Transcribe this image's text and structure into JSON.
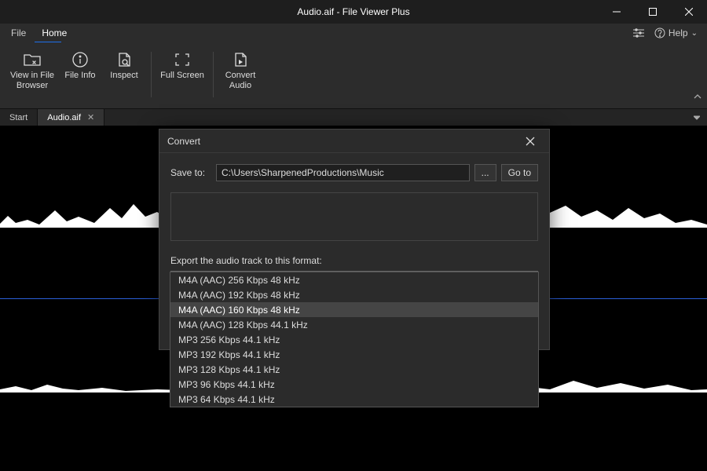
{
  "titlebar": {
    "title": "Audio.aif - File Viewer Plus"
  },
  "menubar": {
    "file": "File",
    "home": "Home",
    "help": "Help ",
    "help_caret": "⌄"
  },
  "ribbon": {
    "view_in_browser": "View in File\nBrowser",
    "file_info": "File Info",
    "inspect": "Inspect",
    "full_screen": "Full Screen",
    "convert_audio": "Convert\nAudio"
  },
  "tabs": {
    "start": "Start",
    "audio": "Audio.aif"
  },
  "dialog": {
    "title": "Convert",
    "save_to_label": "Save to:",
    "save_to_path": "C:\\Users\\SharpenedProductions\\Music",
    "browse": "...",
    "goto": "Go to",
    "export_label": "Export the audio track to this format:",
    "selected_format": "M4A (AAC) 160 Kbps 48 kHz",
    "formats": [
      "M4A (AAC) 256 Kbps 48 kHz",
      "M4A (AAC) 192 Kbps 48 kHz",
      "M4A (AAC) 160 Kbps 48 kHz",
      "M4A (AAC) 128 Kbps 44.1 kHz",
      "MP3 256 Kbps 44.1 kHz",
      "MP3 192 Kbps 44.1 kHz",
      "MP3 128 Kbps 44.1 kHz",
      "MP3 96 Kbps 44.1 kHz",
      "MP3 64 Kbps 44.1 kHz"
    ],
    "selected_index": 2
  }
}
